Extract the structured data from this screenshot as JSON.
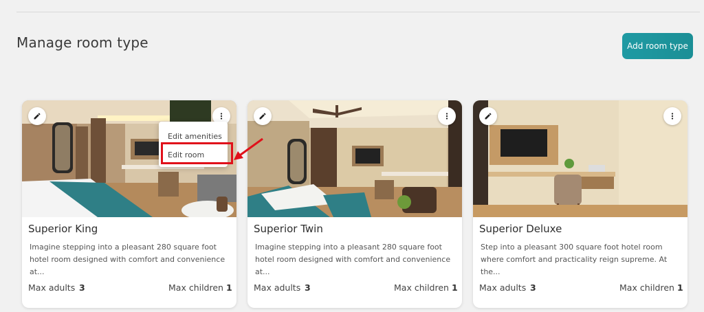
{
  "header": {
    "title": "Manage room type",
    "add_button_label": "Add room type"
  },
  "colors": {
    "accent": "#1b949c",
    "highlight": "#e0101a"
  },
  "cards": [
    {
      "title": "Superior King",
      "description": "Imagine stepping into a pleasant 280 square foot hotel room designed with comfort and convenience at...",
      "max_adults_label": "Max adults",
      "max_adults": "3",
      "max_children_label": "Max children",
      "max_children": "1"
    },
    {
      "title": "Superior Twin",
      "description": "Imagine stepping into a pleasant 280 square foot hotel room designed with comfort and convenience at...",
      "max_adults_label": "Max adults",
      "max_adults": "3",
      "max_children_label": "Max children",
      "max_children": "1"
    },
    {
      "title": "Superior Deluxe",
      "description": "Step into a pleasant 300 square foot hotel room where comfort and practicality reign supreme. At the...",
      "max_adults_label": "Max adults",
      "max_adults": "3",
      "max_children_label": "Max children",
      "max_children": "1"
    }
  ],
  "context_menu": {
    "items": [
      {
        "label": "Edit amenities"
      },
      {
        "label": "Edit room"
      }
    ]
  },
  "icons": {
    "edit": "pencil-icon",
    "more": "more-vert-icon"
  }
}
